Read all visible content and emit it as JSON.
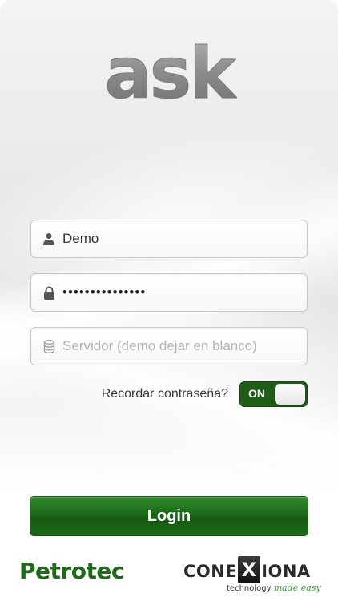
{
  "app": {
    "logo_text": "ask"
  },
  "form": {
    "username": {
      "value": "Demo",
      "icon": "user-icon"
    },
    "password": {
      "value": "•••••••••••••••",
      "icon": "lock-icon"
    },
    "server": {
      "value": "",
      "placeholder": "Servidor (demo dejar en blanco)",
      "icon": "database-icon"
    },
    "remember": {
      "label": "Recordar contraseña?",
      "toggle_text": "ON",
      "checked": true
    },
    "login_label": "Login"
  },
  "footer": {
    "left_brand": "Petrotec",
    "right_brand_prefix": "CONE",
    "right_brand_x": "X",
    "right_brand_suffix": "IONA",
    "tagline_plain": "technology",
    "tagline_accent": "made easy"
  },
  "colors": {
    "brand_green": "#1e6a18",
    "button_green": "#1d6a1a",
    "toggle_green": "#1f5d18",
    "logo_gray": "#8a8a8a"
  }
}
